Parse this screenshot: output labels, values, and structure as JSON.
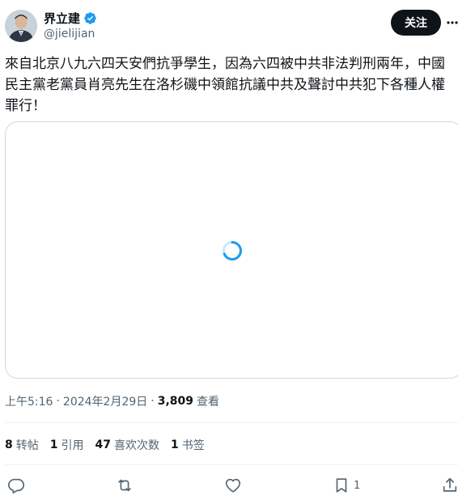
{
  "user": {
    "display_name": "界立建",
    "handle": "@jielijian",
    "verified": true,
    "avatar_icon": "profile-photo"
  },
  "header": {
    "follow_label": "关注",
    "more_icon": "more-icon"
  },
  "tweet": {
    "text": "來自北京八九六四天安們抗爭學生，因為六四被中共非法判刑兩年，中國民主黨老黨員肖亮先生在洛杉磯中領館抗議中共及聲討中共犯下各種人權罪行！",
    "media_state_icon": "loading-spinner-icon"
  },
  "meta": {
    "time": "上午5:16",
    "sep1": "·",
    "date": "2024年2月29日",
    "sep2": "·",
    "views_count": "3,809",
    "views_label": "查看"
  },
  "stats": [
    {
      "count": "8",
      "label": "转帖"
    },
    {
      "count": "1",
      "label": "引用"
    },
    {
      "count": "47",
      "label": "喜欢次数"
    },
    {
      "count": "1",
      "label": "书签"
    }
  ],
  "actions": {
    "bookmark_count": "1"
  },
  "colors": {
    "text": "#0f1419",
    "secondary": "#536471",
    "verified_blue": "#1d9bf0",
    "border": "#cfd9de"
  }
}
